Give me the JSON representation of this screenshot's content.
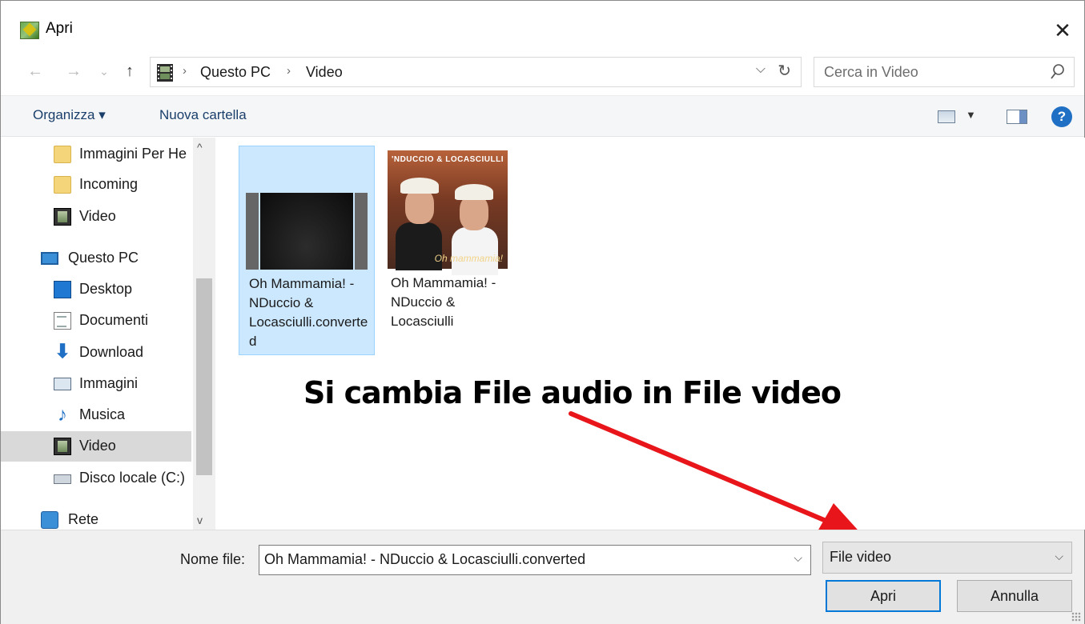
{
  "window": {
    "title": "Apri",
    "close_glyph": "✕"
  },
  "nav": {
    "back": "←",
    "forward": "→",
    "recent": "⌄",
    "up": "↑"
  },
  "address": {
    "crumbs": [
      "Questo PC",
      "Video"
    ],
    "separator": "›",
    "dropdown": "⌵",
    "refresh": "↻"
  },
  "search": {
    "placeholder": "Cerca in Video"
  },
  "toolbar": {
    "organize_label": "Organizza ▾",
    "new_folder_label": "Nuova cartella",
    "view_dropdown": "▼",
    "help": "?"
  },
  "sidebar": {
    "items": [
      {
        "label": "Immagini Per He",
        "icon": "folder-icon"
      },
      {
        "label": "Incoming",
        "icon": "folder-icon"
      },
      {
        "label": "Video",
        "icon": "film-icon"
      },
      {
        "label": "Questo PC",
        "icon": "computer-icon"
      },
      {
        "label": "Desktop",
        "icon": "desktop-icon"
      },
      {
        "label": "Documenti",
        "icon": "document-icon"
      },
      {
        "label": "Download",
        "icon": "download-icon"
      },
      {
        "label": "Immagini",
        "icon": "pictures-icon"
      },
      {
        "label": "Musica",
        "icon": "music-icon"
      },
      {
        "label": "Video",
        "icon": "film-icon",
        "selected": true
      },
      {
        "label": "Disco locale (C:)",
        "icon": "disk-icon"
      },
      {
        "label": "Rete",
        "icon": "network-icon"
      }
    ],
    "scroll_up": "^",
    "scroll_down": "v"
  },
  "files": [
    {
      "name": "Oh Mammamia! - NDuccio & Locasciulli.converted",
      "type": "video",
      "selected": true
    },
    {
      "name": "Oh Mammamia! - NDuccio & Locasciulli",
      "type": "audio-cover",
      "cover_banner": "'NDUCCIO & LOCASCIULLI",
      "cover_script": "Oh mammamia!"
    }
  ],
  "annotation": {
    "text": "Si cambia File audio in File video",
    "arrow_color": "#e8161b"
  },
  "footer": {
    "filename_label": "Nome file:",
    "filename_value": "Oh Mammamia! - NDuccio & Locasciulli.converted",
    "filetype_value": "File video",
    "dropdown": "⌵",
    "open_label": "Apri",
    "cancel_label": "Annulla"
  },
  "colors": {
    "selection": "#cce8ff",
    "accent": "#0078d7",
    "link": "#1a3f6b"
  }
}
